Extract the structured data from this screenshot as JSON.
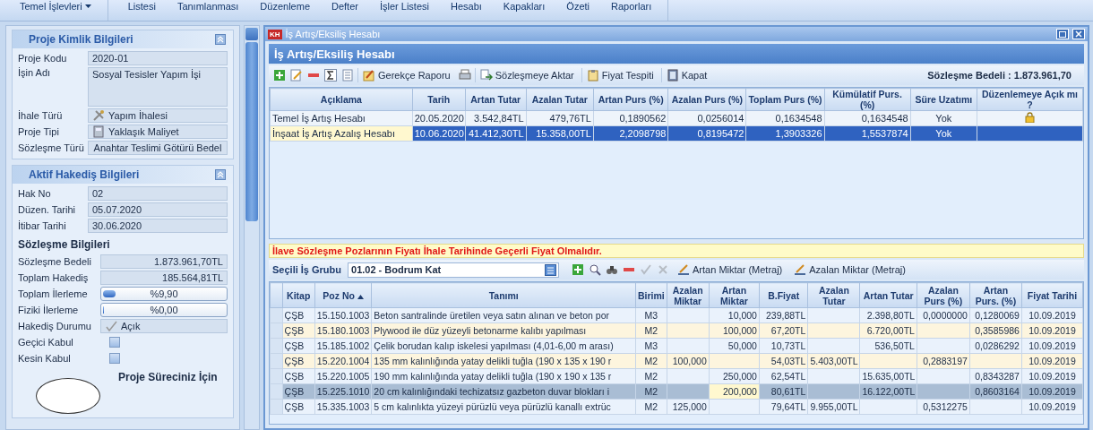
{
  "ribbon": {
    "groups": [
      {
        "items": [
          {
            "label": "Temel İşlevleri",
            "dropdown": true
          }
        ]
      },
      {
        "items": [
          {
            "label": "Listesi",
            "dropdown": false
          },
          {
            "label": "Tanımlanması",
            "dropdown": false
          },
          {
            "label": "Düzenleme",
            "dropdown": false
          },
          {
            "label": "Defter",
            "dropdown": false
          },
          {
            "label": "İşler Listesi",
            "dropdown": false
          },
          {
            "label": "Hesabı",
            "dropdown": false
          },
          {
            "label": "Kapakları",
            "dropdown": false
          },
          {
            "label": "Özeti",
            "dropdown": false
          },
          {
            "label": "Raporları",
            "dropdown": false
          }
        ]
      }
    ]
  },
  "left_panel": {
    "sections": [
      {
        "title": "Proje Kimlik Bilgileri",
        "rows": [
          {
            "kind": "text",
            "label": "Proje Kodu",
            "value": "2020-01"
          },
          {
            "kind": "multiline",
            "label": "İşin Adı",
            "value": "Sosyal Tesisler Yapım İşi"
          },
          {
            "kind": "icon_text",
            "label": "İhale Türü",
            "value": "Yapım İhalesi"
          },
          {
            "kind": "icon_text",
            "label": "Proje Tipi",
            "value": "Yaklaşık Maliyet"
          },
          {
            "kind": "centered",
            "label": "Sözleşme Türü",
            "value": "Anahtar Teslimi Götürü Bedel"
          }
        ]
      },
      {
        "title": "Aktif Hakediş Bilgileri",
        "rows": [
          {
            "kind": "text",
            "label": "Hak No",
            "value": "02"
          },
          {
            "kind": "text",
            "label": "Düzen. Tarihi",
            "value": "05.07.2020"
          },
          {
            "kind": "text",
            "label": "İtibar Tarihi",
            "value": "30.06.2020"
          },
          {
            "kind": "subtitle",
            "label": "Sözleşme Bilgileri"
          },
          {
            "kind": "amount",
            "label": "Sözleşme Bedeli",
            "value": "1.873.961,70TL"
          },
          {
            "kind": "amount",
            "label": "Toplam Hakediş",
            "value": "185.564,81TL"
          },
          {
            "kind": "progress",
            "label": "Toplam İlerleme",
            "value": "%9,90",
            "level": 0.099
          },
          {
            "kind": "progress",
            "label": "Fiziki İlerleme",
            "value": "%0,00",
            "level": 0
          },
          {
            "kind": "status",
            "label": "Hakediş Durumu",
            "value": "Açık"
          },
          {
            "kind": "checkbox",
            "label": "Geçici Kabul",
            "checked": false
          },
          {
            "kind": "checkbox",
            "label": "Kesin Kabul",
            "checked": false
          }
        ],
        "footer": {
          "title": "Proje Süreciniz İçin"
        }
      }
    ]
  },
  "window": {
    "badge": "KH",
    "title": "İş Artış/Eksiliş Hesabı",
    "header": "İş Artış/Eksiliş Hesabı",
    "toolbar": [
      {
        "kind": "icon"
      },
      {
        "kind": "icon"
      },
      {
        "kind": "icon"
      },
      {
        "kind": "icon"
      },
      {
        "kind": "icon"
      },
      {
        "kind": "button",
        "label": "Gerekçe Raporu"
      },
      {
        "kind": "icon"
      },
      {
        "kind": "button",
        "label": "Sözleşmeye Aktar"
      },
      {
        "kind": "button",
        "label": "Fiyat Tespiti"
      },
      {
        "kind": "button",
        "label": "Kapat"
      }
    ],
    "contract_total": "Sözleşme Bedeli : 1.873.961,70",
    "table": {
      "columns": [
        "Açıklama",
        "Tarih",
        "Artan Tutar",
        "Azalan Tutar",
        "Artan Purs (%)",
        "Azalan Purs (%)",
        "Toplam Purs (%)",
        "Kümülatif Purs. (%)",
        "Süre Uzatımı",
        "Düzenlemeye Açık mı ?"
      ],
      "rows": [
        {
          "selected": false,
          "locked": true,
          "cells": [
            {
              "text": "Temel İş Artış Hesabı",
              "focused": false
            },
            {
              "text": "20.05.2020",
              "focused": false
            },
            {
              "text": "3.542,84TL",
              "focused": false
            },
            {
              "text": "479,76TL",
              "focused": false
            },
            {
              "text": "0,1890562",
              "focused": false
            },
            {
              "text": "0,0256014",
              "focused": false
            },
            {
              "text": "0,1634548",
              "focused": false
            },
            {
              "text": "0,1634548",
              "focused": false
            },
            {
              "text": "Yok",
              "focused": false
            }
          ]
        },
        {
          "selected": true,
          "locked": false,
          "cells": [
            {
              "text": "İnşaat İş Artış Azalış Hesabı",
              "focused": true
            },
            {
              "text": "10.06.2020",
              "focused": false
            },
            {
              "text": "41.412,30TL",
              "focused": false
            },
            {
              "text": "15.358,00TL",
              "focused": false
            },
            {
              "text": "2,2098798",
              "focused": false
            },
            {
              "text": "0,8195472",
              "focused": false
            },
            {
              "text": "1,3903326",
              "focused": false
            },
            {
              "text": "1,5537874",
              "focused": false
            },
            {
              "text": "Yok",
              "focused": false
            }
          ]
        }
      ]
    },
    "warning": "İlave Sözleşme Pozlarının Fiyatı İhale Tarihinde Geçerli Fiyat Olmalıdır.",
    "group_label": "Seçili İş Grubu",
    "group_value": "01.02 - Bodrum Kat",
    "toolbar2": [
      {
        "kind": "icon",
        "disabled": false
      },
      {
        "kind": "icon",
        "disabled": false
      },
      {
        "kind": "icon",
        "disabled": false
      },
      {
        "kind": "icon",
        "disabled": false
      },
      {
        "kind": "icon",
        "disabled": true
      },
      {
        "kind": "icon",
        "disabled": true
      },
      {
        "kind": "button",
        "label": "Artan Miktar (Metraj)",
        "disabled": false
      },
      {
        "kind": "button",
        "label": "Azalan Miktar (Metraj)",
        "disabled": false
      }
    ],
    "items": {
      "columns": [
        {
          "label": "Kitap",
          "sorted": false
        },
        {
          "label": "Poz No",
          "sorted": true
        },
        {
          "label": "Tanımı",
          "sorted": false
        },
        {
          "label": "Birimi",
          "sorted": false
        },
        {
          "label": "Azalan Miktar",
          "sorted": false
        },
        {
          "label": "Artan Miktar",
          "sorted": false
        },
        {
          "label": "B.Fiyat",
          "sorted": false
        },
        {
          "label": "Azalan Tutar",
          "sorted": false
        },
        {
          "label": "Artan Tutar",
          "sorted": false
        },
        {
          "label": "Azalan Purs (%)",
          "sorted": false
        },
        {
          "label": "Artan Purs. (%)",
          "sorted": false
        },
        {
          "label": "Fiyat Tarihi",
          "sorted": false
        }
      ],
      "rows": [
        {
          "selected": false,
          "cells": [
            {
              "text": "ÇŞB",
              "focused": false
            },
            {
              "text": "15.150.1003",
              "focused": false
            },
            {
              "text": "Beton santralinde üretilen veya satın alınan ve beton por",
              "focused": false
            },
            {
              "text": "M3",
              "focused": false
            },
            {
              "focused": false
            },
            {
              "text": "10,000",
              "focused": false
            },
            {
              "text": "239,88TL",
              "focused": false
            },
            {
              "focused": false
            },
            {
              "text": "2.398,80TL",
              "focused": false
            },
            {
              "text": "0,0000000",
              "focused": false
            },
            {
              "text": "0,1280069",
              "focused": false
            },
            {
              "text": "10.09.2019",
              "focused": false
            }
          ]
        },
        {
          "selected": false,
          "cells": [
            {
              "text": "ÇŞB",
              "focused": false
            },
            {
              "text": "15.180.1003",
              "focused": false
            },
            {
              "text": "Plywood ile düz yüzeyli betonarme kalıbı yapılması",
              "focused": false
            },
            {
              "text": "M2",
              "focused": false
            },
            {
              "focused": false
            },
            {
              "text": "100,000",
              "focused": false
            },
            {
              "text": "67,20TL",
              "focused": false
            },
            {
              "focused": false
            },
            {
              "text": "6.720,00TL",
              "focused": false
            },
            {
              "focused": false
            },
            {
              "text": "0,3585986",
              "focused": false
            },
            {
              "text": "10.09.2019",
              "focused": false
            }
          ]
        },
        {
          "selected": false,
          "cells": [
            {
              "text": "ÇŞB",
              "focused": false
            },
            {
              "text": "15.185.1002",
              "focused": false
            },
            {
              "text": "Çelik borudan kalıp iskelesi yapılması (4,01-6,00 m arası)",
              "focused": false
            },
            {
              "text": "M3",
              "focused": false
            },
            {
              "focused": false
            },
            {
              "text": "50,000",
              "focused": false
            },
            {
              "text": "10,73TL",
              "focused": false
            },
            {
              "focused": false
            },
            {
              "text": "536,50TL",
              "focused": false
            },
            {
              "focused": false
            },
            {
              "text": "0,0286292",
              "focused": false
            },
            {
              "text": "10.09.2019",
              "focused": false
            }
          ]
        },
        {
          "selected": false,
          "cells": [
            {
              "text": "ÇŞB",
              "focused": false
            },
            {
              "text": "15.220.1004",
              "focused": false
            },
            {
              "text": "135 mm kalınlığında yatay delikli tuğla (190 x 135 x 190 r",
              "focused": false
            },
            {
              "text": "M2",
              "focused": false
            },
            {
              "text": "100,000",
              "focused": false
            },
            {
              "focused": false
            },
            {
              "text": "54,03TL",
              "focused": false
            },
            {
              "text": "5.403,00TL",
              "focused": false
            },
            {
              "focused": false
            },
            {
              "text": "0,2883197",
              "focused": false
            },
            {
              "focused": false
            },
            {
              "text": "10.09.2019",
              "focused": false
            }
          ]
        },
        {
          "selected": false,
          "cells": [
            {
              "text": "ÇŞB",
              "focused": false
            },
            {
              "text": "15.220.1005",
              "focused": false
            },
            {
              "text": "190 mm kalınlığında yatay delikli tuğla (190 x 190 x 135 r",
              "focused": false
            },
            {
              "text": "M2",
              "focused": false
            },
            {
              "focused": false
            },
            {
              "text": "250,000",
              "focused": false
            },
            {
              "text": "62,54TL",
              "focused": false
            },
            {
              "focused": false
            },
            {
              "text": "15.635,00TL",
              "focused": false
            },
            {
              "focused": false
            },
            {
              "text": "0,8343287",
              "focused": false
            },
            {
              "text": "10.09.2019",
              "focused": false
            }
          ]
        },
        {
          "selected": true,
          "cells": [
            {
              "text": "ÇŞB",
              "focused": false
            },
            {
              "text": "15.225.1010",
              "focused": false
            },
            {
              "text": "20 cm kalınlığındaki techizatsız gazbeton duvar blokları i",
              "focused": false
            },
            {
              "text": "M2",
              "focused": false
            },
            {
              "focused": false
            },
            {
              "text": "200,000",
              "focused": true
            },
            {
              "text": "80,61TL",
              "focused": false
            },
            {
              "focused": false
            },
            {
              "text": "16.122,00TL",
              "focused": false
            },
            {
              "focused": false
            },
            {
              "text": "0,8603164",
              "focused": false
            },
            {
              "text": "10.09.2019",
              "focused": false
            }
          ]
        },
        {
          "selected": false,
          "cells": [
            {
              "text": "ÇŞB",
              "focused": false
            },
            {
              "text": "15.335.1003",
              "focused": false
            },
            {
              "text": "5 cm kalınlıkta yüzeyi pürüzlü veya pürüzlü kanallı extrüc",
              "focused": false
            },
            {
              "text": "M2",
              "focused": false
            },
            {
              "text": "125,000",
              "focused": false
            },
            {
              "focused": false
            },
            {
              "text": "79,64TL",
              "focused": false
            },
            {
              "text": "9.955,00TL",
              "focused": false
            },
            {
              "focused": false
            },
            {
              "text": "0,5312275",
              "focused": false
            },
            {
              "focused": false
            },
            {
              "text": "10.09.2019",
              "focused": false
            }
          ]
        }
      ]
    }
  }
}
